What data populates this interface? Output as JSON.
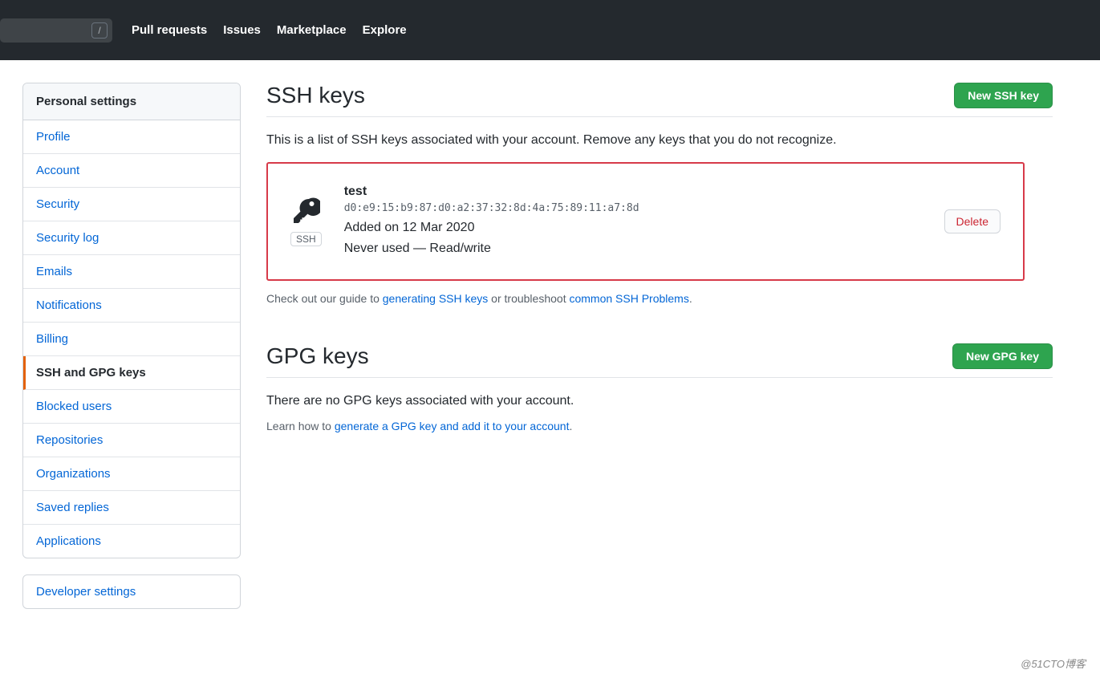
{
  "topnav": {
    "items": [
      "Pull requests",
      "Issues",
      "Marketplace",
      "Explore"
    ],
    "slash": "/"
  },
  "sidebar": {
    "header": "Personal settings",
    "items": [
      "Profile",
      "Account",
      "Security",
      "Security log",
      "Emails",
      "Notifications",
      "Billing",
      "SSH and GPG keys",
      "Blocked users",
      "Repositories",
      "Organizations",
      "Saved replies",
      "Applications"
    ],
    "active_index": 7,
    "developer": "Developer settings"
  },
  "ssh": {
    "heading": "SSH keys",
    "new_button": "New SSH key",
    "description": "This is a list of SSH keys associated with your account. Remove any keys that you do not recognize.",
    "key": {
      "badge": "SSH",
      "title": "test",
      "fingerprint": "d0:e9:15:b9:87:d0:a2:37:32:8d:4a:75:89:11:a7:8d",
      "added": "Added on 12 Mar 2020",
      "usage": "Never used — Read/write",
      "delete": "Delete"
    },
    "guide_prefix": "Check out our guide to ",
    "guide_link1": "generating SSH keys",
    "guide_mid": " or troubleshoot ",
    "guide_link2": "common SSH Problems",
    "guide_suffix": "."
  },
  "gpg": {
    "heading": "GPG keys",
    "new_button": "New GPG key",
    "empty": "There are no GPG keys associated with your account.",
    "learn_prefix": "Learn how to ",
    "learn_link": "generate a GPG key and add it to your account",
    "learn_suffix": "."
  },
  "watermark": "@51CTO博客"
}
